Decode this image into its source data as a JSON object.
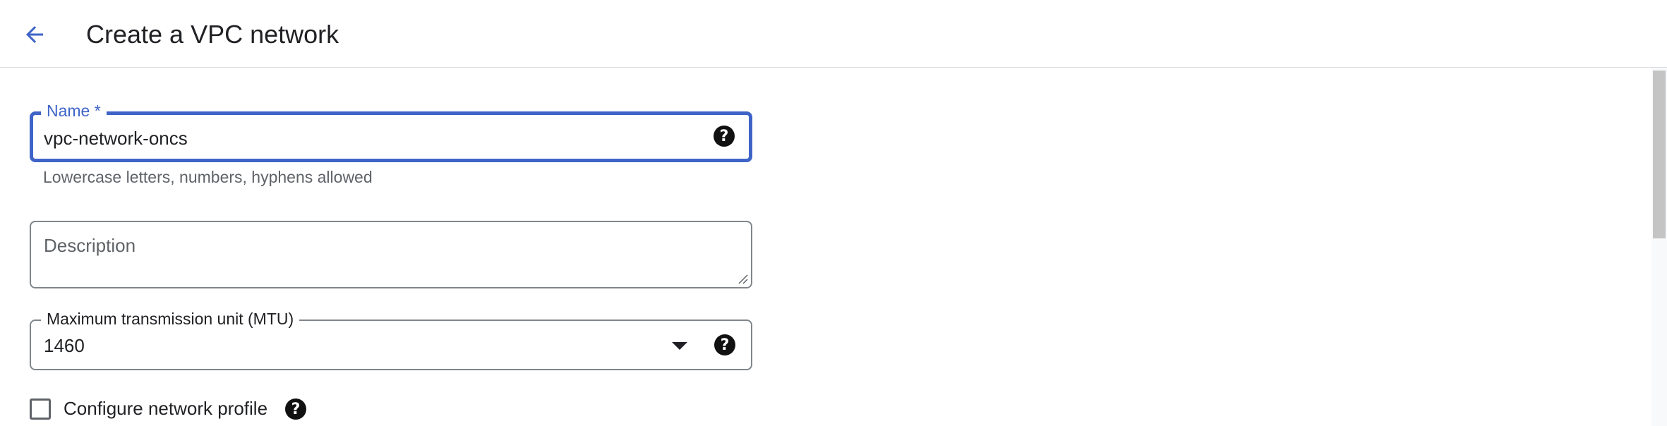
{
  "header": {
    "title": "Create a VPC network",
    "back_icon": "arrow-back-icon"
  },
  "form": {
    "name": {
      "label": "Name *",
      "value": "vpc-network-oncs",
      "hint": "Lowercase letters, numbers, hyphens allowed",
      "help_icon": "help-icon"
    },
    "description": {
      "placeholder": "Description",
      "value": ""
    },
    "mtu": {
      "label": "Maximum transmission unit (MTU)",
      "value": "1460",
      "help_icon": "help-icon"
    },
    "network_profile": {
      "label": "Configure network profile",
      "checked": false,
      "help_icon": "help-icon"
    }
  },
  "colors": {
    "accent": "#3f64c8",
    "text": "#202124",
    "secondary_text": "#5f6368",
    "border": "#80868b"
  }
}
